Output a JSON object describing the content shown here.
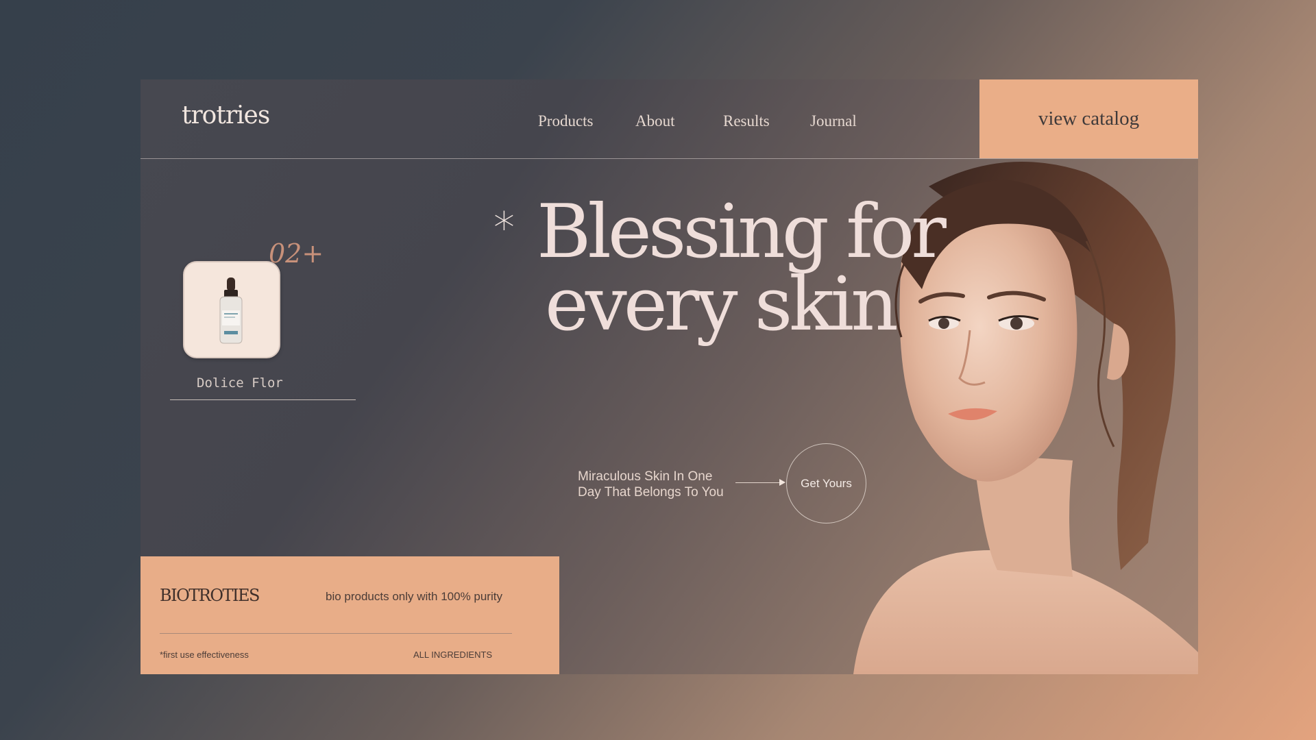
{
  "brand": {
    "logo": "trotries"
  },
  "nav": {
    "items": [
      "Products",
      "About",
      "Results",
      "Journal"
    ]
  },
  "header": {
    "cta_label": "view catalog"
  },
  "hero": {
    "asterisk": "*",
    "headline_line1": "Blessing for",
    "headline_line2": "every skin",
    "tagline_line1": "Miraculous Skin In One",
    "tagline_line2": "Day That Belongs To You",
    "button_label": "Get Yours",
    "image_icon": "woman-portrait-photo"
  },
  "product_card": {
    "count_badge": "02+",
    "name": "Dolice Flor",
    "image_icon": "serum-dropper-bottle"
  },
  "promo": {
    "brand": "BIOTROTIES",
    "description": "bio products only with 100% purity",
    "note": "*first use effectiveness",
    "link": "ALL INGREDIENTS"
  },
  "colors": {
    "accent": "#eaae88",
    "card_dark": "#45454d",
    "headline": "#efdeda",
    "page_bg_dark": "#36404b"
  }
}
